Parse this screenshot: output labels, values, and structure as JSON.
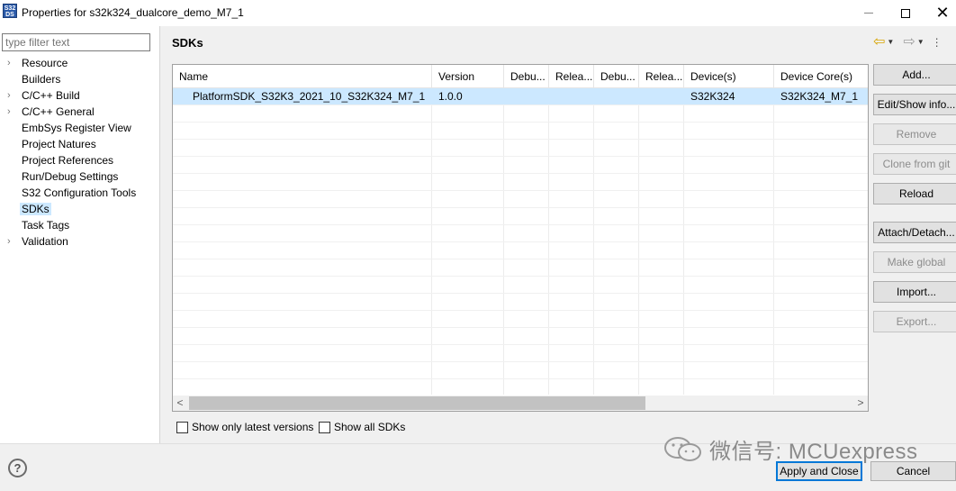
{
  "window": {
    "title": "Properties for s32k324_dualcore_demo_M7_1",
    "icon_text": "S32 DS",
    "minimize": "—",
    "close": "✕"
  },
  "sidebar": {
    "filter_placeholder": "type filter text",
    "items": [
      {
        "label": "Resource",
        "expandable": true,
        "selected": false
      },
      {
        "label": "Builders",
        "expandable": false,
        "selected": false
      },
      {
        "label": "C/C++ Build",
        "expandable": true,
        "selected": false
      },
      {
        "label": "C/C++ General",
        "expandable": true,
        "selected": false
      },
      {
        "label": "EmbSys Register View",
        "expandable": false,
        "selected": false
      },
      {
        "label": "Project Natures",
        "expandable": false,
        "selected": false
      },
      {
        "label": "Project References",
        "expandable": false,
        "selected": false
      },
      {
        "label": "Run/Debug Settings",
        "expandable": false,
        "selected": false
      },
      {
        "label": "S32 Configuration Tools",
        "expandable": false,
        "selected": false
      },
      {
        "label": "SDKs",
        "expandable": false,
        "selected": true
      },
      {
        "label": "Task Tags",
        "expandable": false,
        "selected": false
      },
      {
        "label": "Validation",
        "expandable": true,
        "selected": false
      }
    ],
    "expand_glyph": "›"
  },
  "page": {
    "title": "SDKs",
    "nav": {
      "back": "⇦",
      "forward": "⇨",
      "dropdown": "▼",
      "more": "⋮"
    }
  },
  "table": {
    "columns": [
      "Name",
      "Version",
      "Debu...",
      "Relea...",
      "Debu...",
      "Relea...",
      "Device(s)",
      "Device Core(s)"
    ],
    "rows": [
      [
        "PlatformSDK_S32K3_2021_10_S32K324_M7_1",
        "1.0.0",
        "",
        "",
        "",
        "",
        "S32K324",
        "S32K324_M7_1"
      ]
    ],
    "selected_row": 0,
    "scroll_left": "<",
    "scroll_right": ">"
  },
  "buttons": [
    {
      "label": "Add...",
      "enabled": true
    },
    {
      "label": "Edit/Show info...",
      "enabled": true
    },
    {
      "label": "Remove",
      "enabled": false
    },
    {
      "label": "Clone from git",
      "enabled": false
    },
    {
      "label": "Reload",
      "enabled": true
    },
    {
      "label": "Attach/Detach...",
      "enabled": true
    },
    {
      "label": "Make global",
      "enabled": false
    },
    {
      "label": "Import...",
      "enabled": true
    },
    {
      "label": "Export...",
      "enabled": false
    }
  ],
  "options": {
    "latest_versions": {
      "label": "Show only latest versions",
      "checked": false
    },
    "all_sdks": {
      "label": "Show all SDKs",
      "checked": false
    }
  },
  "footer": {
    "help": "?",
    "watermark": "微信号: MCUexpress",
    "apply_close": "Apply and Close",
    "cancel": "Cancel"
  }
}
